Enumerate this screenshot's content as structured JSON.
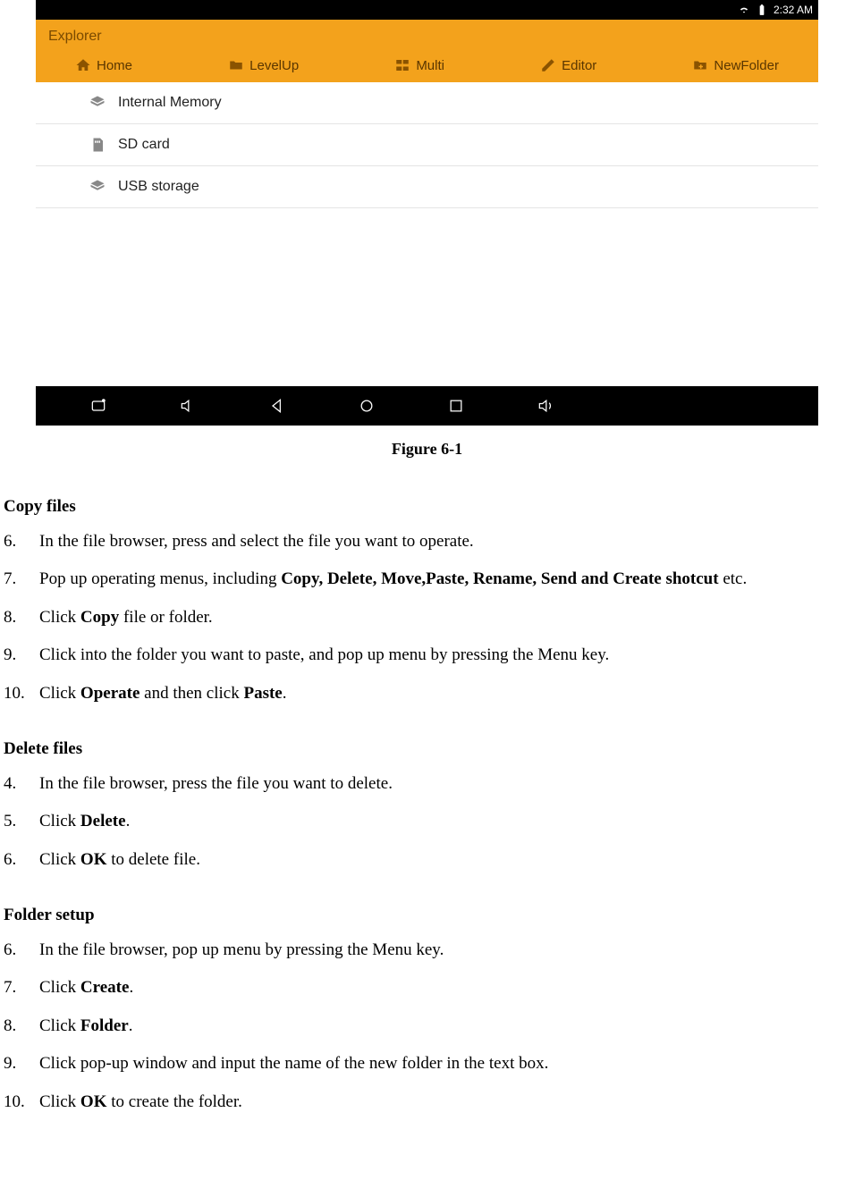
{
  "statusbar": {
    "time": "2:32 AM"
  },
  "app": {
    "title": "Explorer"
  },
  "toolbar": [
    {
      "name": "home",
      "label": "Home"
    },
    {
      "name": "levelup",
      "label": "LevelUp"
    },
    {
      "name": "multi",
      "label": "Multi"
    },
    {
      "name": "editor",
      "label": "Editor"
    },
    {
      "name": "newfolder",
      "label": "NewFolder"
    }
  ],
  "storage": [
    {
      "name": "internal",
      "label": "Internal Memory"
    },
    {
      "name": "sdcard",
      "label": "SD card"
    },
    {
      "name": "usb",
      "label": "USB storage"
    }
  ],
  "caption": "Figure 6-1",
  "sections": {
    "copy": {
      "title": "Copy files",
      "start": 6,
      "steps": [
        [
          {
            "t": "In the file browser, press and select the file you want to operate."
          }
        ],
        [
          {
            "t": "Pop up operating menus, including "
          },
          {
            "t": "Copy, Delete, Move,Paste, Rename, Send and Create shotcut",
            "b": true
          },
          {
            "t": " etc."
          }
        ],
        [
          {
            "t": "Click "
          },
          {
            "t": "Copy",
            "b": true
          },
          {
            "t": " file or folder."
          }
        ],
        [
          {
            "t": "Click into the folder you want to paste, and pop up menu by pressing the Menu key."
          }
        ],
        [
          {
            "t": "Click "
          },
          {
            "t": "Operate",
            "b": true
          },
          {
            "t": " and then click "
          },
          {
            "t": "Paste",
            "b": true
          },
          {
            "t": "."
          }
        ]
      ]
    },
    "delete": {
      "title": "Delete files",
      "start": 4,
      "steps": [
        [
          {
            "t": "In the file browser, press the file you want to delete."
          }
        ],
        [
          {
            "t": "Click "
          },
          {
            "t": "Delete",
            "b": true
          },
          {
            "t": "."
          }
        ],
        [
          {
            "t": "Click "
          },
          {
            "t": "OK",
            "b": true
          },
          {
            "t": " to delete file."
          }
        ]
      ]
    },
    "folder": {
      "title": "Folder setup",
      "start": 6,
      "steps": [
        [
          {
            "t": "In the file browser, pop up menu by pressing the Menu key."
          }
        ],
        [
          {
            "t": "Click "
          },
          {
            "t": "Create",
            "b": true
          },
          {
            "t": "."
          }
        ],
        [
          {
            "t": "Click "
          },
          {
            "t": "Folder",
            "b": true
          },
          {
            "t": "."
          }
        ],
        [
          {
            "t": "Click pop-up window and input the name of the new folder in the text box."
          }
        ],
        [
          {
            "t": "Click "
          },
          {
            "t": "OK",
            "b": true
          },
          {
            "t": " to create the folder."
          }
        ]
      ]
    }
  }
}
